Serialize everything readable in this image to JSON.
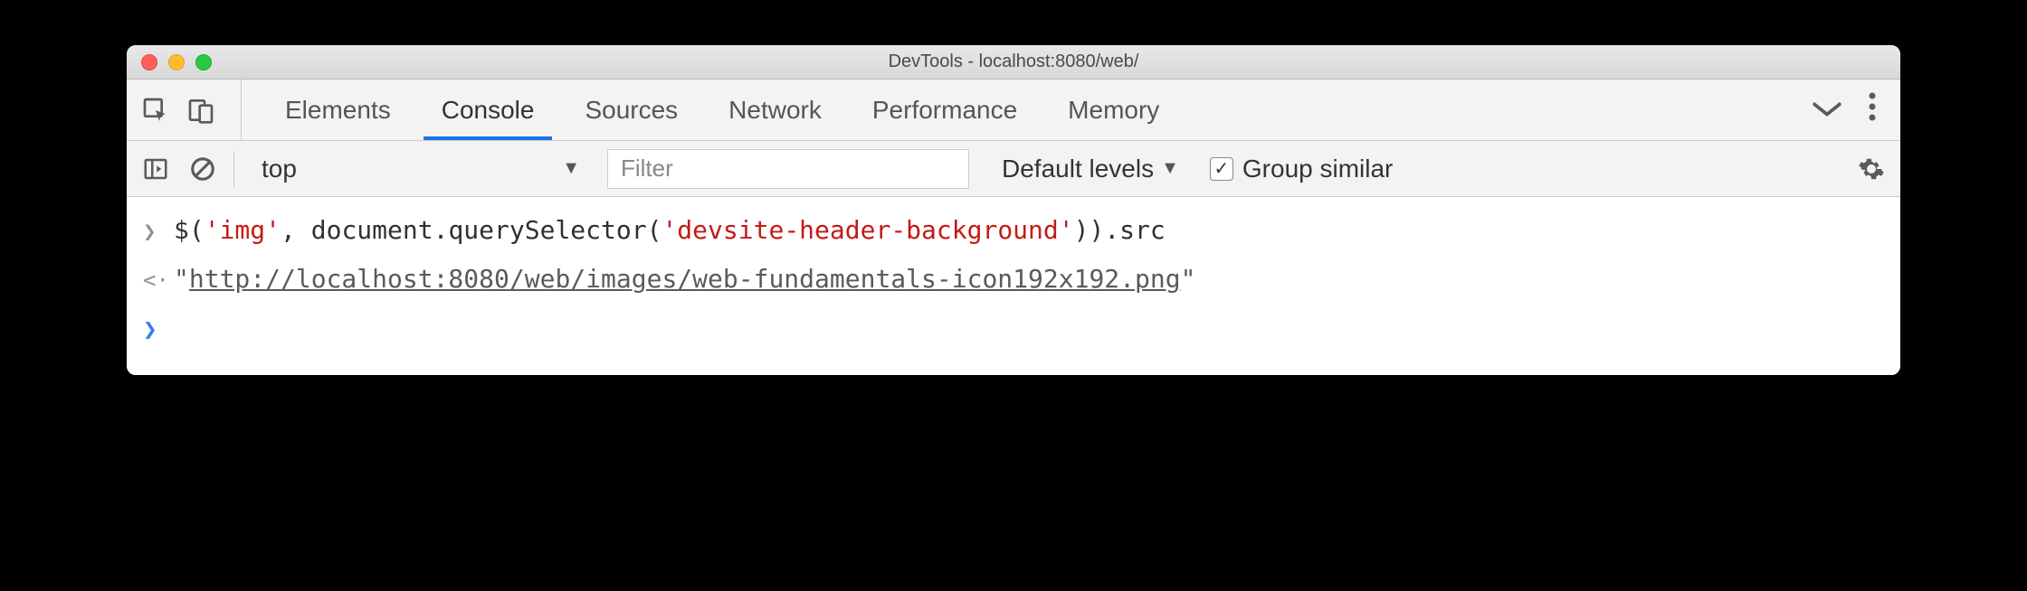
{
  "window": {
    "title": "DevTools - localhost:8080/web/"
  },
  "tabs": {
    "items": [
      "Elements",
      "Console",
      "Sources",
      "Network",
      "Performance",
      "Memory"
    ],
    "active": "Console"
  },
  "toolbar": {
    "context": "top",
    "filter_placeholder": "Filter",
    "levels_label": "Default levels",
    "group_similar_label": "Group similar",
    "group_similar_checked": true
  },
  "console": {
    "input": {
      "fn1": "$",
      "str1": "'img'",
      "mid": ", document.querySelector(",
      "str2": "'devsite-header-background'",
      "end": ")).src"
    },
    "output": {
      "quote": "\"",
      "url": "http://localhost:8080/web/images/web-fundamentals-icon192x192.png"
    }
  }
}
